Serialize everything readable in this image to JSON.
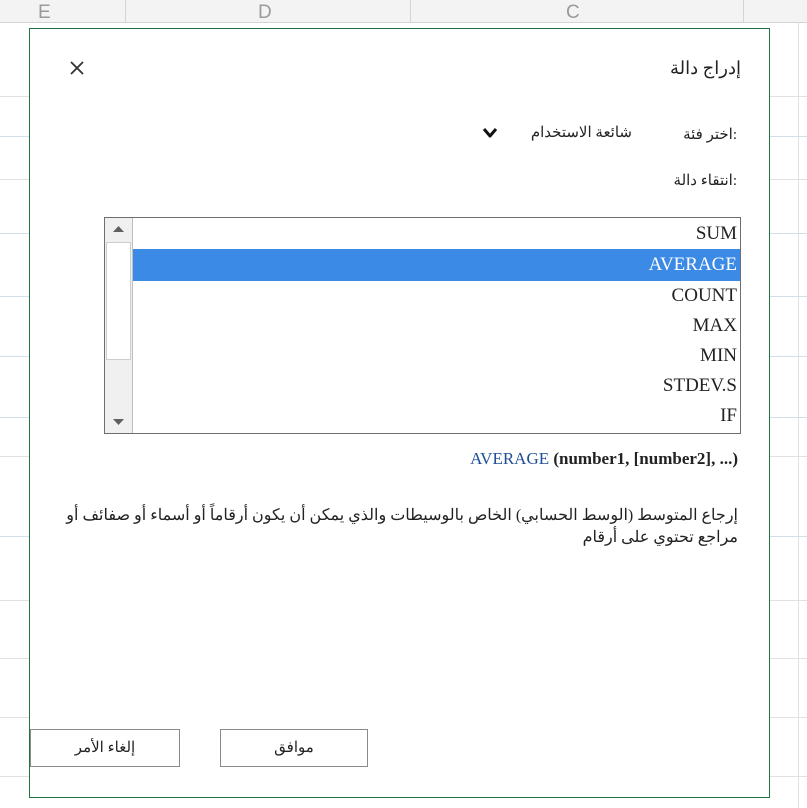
{
  "sheet": {
    "column_letters": [
      "E",
      "D",
      "C"
    ]
  },
  "dialog": {
    "title": "إدراج دالة",
    "close_icon": "close-icon",
    "category_label": "اختر فئة:",
    "category_value": "شائعة الاستخدام",
    "category_chevron_icon": "chevron-down-icon",
    "pick_label": "انتقاء دالة:",
    "functions": [
      "SUM",
      "AVERAGE",
      "COUNT",
      "MAX",
      "MIN",
      "STDEV.S",
      "IF"
    ],
    "selected_function": "AVERAGE",
    "signature_name": "AVERAGE",
    "signature_args": "(number1, [number2], ...)",
    "description": "إرجاع المتوسط (الوسط الحسابي) الخاص بالوسيطات والذي يمكن أن يكون أرقاماً أو أسماء أو صفائف أو مراجع تحتوي على أرقام",
    "ok_label": "موافق",
    "cancel_label": "إلغاء الأمر",
    "accent_color": "#217346",
    "selection_color": "#3b8ae6"
  }
}
